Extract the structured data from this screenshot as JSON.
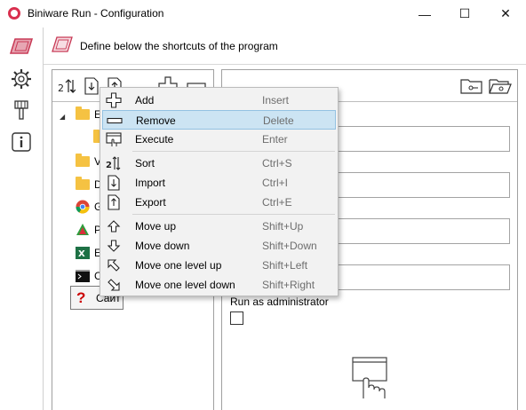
{
  "window": {
    "title": "Biniware Run - Configuration",
    "minimize_glyph": "—",
    "maximize_glyph": "☐",
    "close_glyph": "✕"
  },
  "leftbar": {
    "items": [
      {
        "icon": "shortcuts-icon"
      },
      {
        "icon": "settings-gear-icon"
      },
      {
        "icon": "brush-icon"
      },
      {
        "icon": "info-icon"
      }
    ]
  },
  "header": {
    "icon": "shortcuts-icon",
    "text": "Define below the shortcuts of the program"
  },
  "tree_toolbar": {
    "buttons": [
      "sort-icon",
      "import-icon",
      "export-icon",
      "add-icon",
      "remove-icon"
    ]
  },
  "tree": {
    "nodes": [
      {
        "label": "E",
        "icon": "folder-icon",
        "expanded": true
      },
      {
        "label": "",
        "icon": "folder-icon"
      },
      {
        "label": "V",
        "icon": "folder-icon"
      },
      {
        "label": "D",
        "icon": "folder-icon"
      },
      {
        "label": "G",
        "icon": "chrome-icon"
      },
      {
        "label": "P",
        "icon": "app-icon"
      },
      {
        "label": "E",
        "icon": "excel-icon"
      },
      {
        "label": "C",
        "icon": "console-icon"
      }
    ],
    "selected_node_label": "Сайт"
  },
  "detail_toolbar": {
    "buttons": [
      "open-folder-key-icon",
      "browse-folder-icon"
    ]
  },
  "details": {
    "run_as_admin_label": "Run as administrator",
    "run_as_admin_checked": false
  },
  "context_menu": {
    "items": [
      {
        "label": "Add",
        "shortcut": "Insert",
        "icon": "plus-icon",
        "highlighted": false
      },
      {
        "label": "Remove",
        "shortcut": "Delete",
        "icon": "minus-icon",
        "highlighted": true
      },
      {
        "label": "Execute",
        "shortcut": "Enter",
        "icon": "execute-icon",
        "highlighted": false
      },
      {
        "label": "Sort",
        "shortcut": "Ctrl+S",
        "icon": "sort-icon",
        "highlighted": false
      },
      {
        "label": "Import",
        "shortcut": "Ctrl+I",
        "icon": "import-icon",
        "highlighted": false
      },
      {
        "label": "Export",
        "shortcut": "Ctrl+E",
        "icon": "export-icon",
        "highlighted": false
      },
      {
        "label": "Move up",
        "shortcut": "Shift+Up",
        "icon": "arrow-up-icon",
        "highlighted": false
      },
      {
        "label": "Move down",
        "shortcut": "Shift+Down",
        "icon": "arrow-down-icon",
        "highlighted": false
      },
      {
        "label": "Move one level up",
        "shortcut": "Shift+Left",
        "icon": "arrow-level-up-icon",
        "highlighted": false
      },
      {
        "label": "Move one level down",
        "shortcut": "Shift+Right",
        "icon": "arrow-level-down-icon",
        "highlighted": false
      }
    ]
  },
  "colors": {
    "accent": "#d9304f",
    "menu_highlight": "#cce4f3",
    "menu_highlight_border": "#93c2e2"
  }
}
